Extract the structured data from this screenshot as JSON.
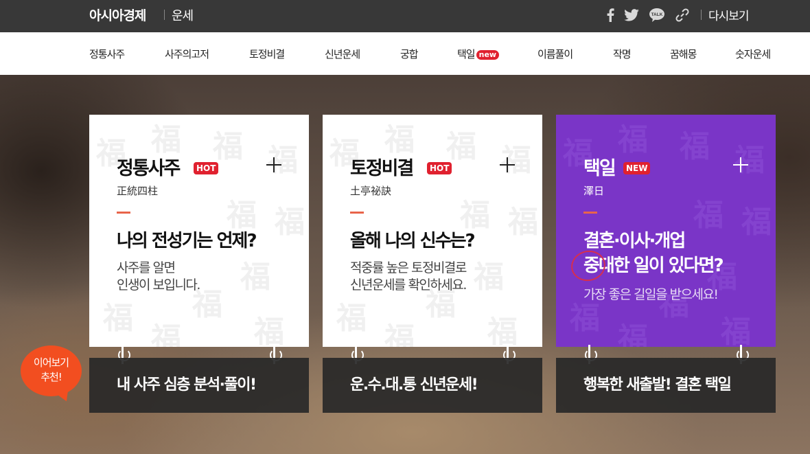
{
  "header": {
    "brand": "아시아경제",
    "section": "운세",
    "social_icons": [
      "facebook-icon",
      "twitter-icon",
      "kakaotalk-icon",
      "link-icon"
    ],
    "talk_label": "TALK",
    "readmore_label": "다시보기"
  },
  "nav": {
    "items": [
      {
        "label": "정통사주"
      },
      {
        "label": "사주의고저"
      },
      {
        "label": "토정비결"
      },
      {
        "label": "신년운세"
      },
      {
        "label": "궁합"
      },
      {
        "label": "택일",
        "badge": "new"
      },
      {
        "label": "이름풀이"
      },
      {
        "label": "작명"
      },
      {
        "label": "꿈해몽"
      },
      {
        "label": "숫자운세"
      }
    ]
  },
  "cards": [
    {
      "title": "정통사주",
      "badge": "HOT",
      "hanja": "正統四柱",
      "headline": "나의 전성기는 언제?",
      "desc_line1": "사주를 알면",
      "desc_line2": "인생이 보입니다.",
      "bar_label": "내 사주 심층 분석·풀이!"
    },
    {
      "title": "토정비결",
      "badge": "HOT",
      "hanja": "土亭祕訣",
      "headline": "올해 나의 신수는?",
      "desc_line1": "적중률 높은 토정비결로",
      "desc_line2": "신년운세를 확인하세요.",
      "bar_label": "운.수.대.통 신년운세!"
    },
    {
      "title": "택일",
      "badge": "NEW",
      "hanja": "澤日",
      "headline_line1": "결혼·이사·개업",
      "headline_line2": "중대한 일이 있다면?",
      "desc_line1": "가장 좋은 길일을 받으세요!",
      "bar_label": "행복한 새출발! 결혼 택일"
    }
  ],
  "bubble": {
    "line1": "이어보기",
    "line2": "추천!"
  },
  "colors": {
    "topbar": "#383838",
    "accent_red": "#e0212f",
    "purple": "#7a35c7",
    "accent_line": "#e8644a",
    "bubble": "#f24e20"
  }
}
